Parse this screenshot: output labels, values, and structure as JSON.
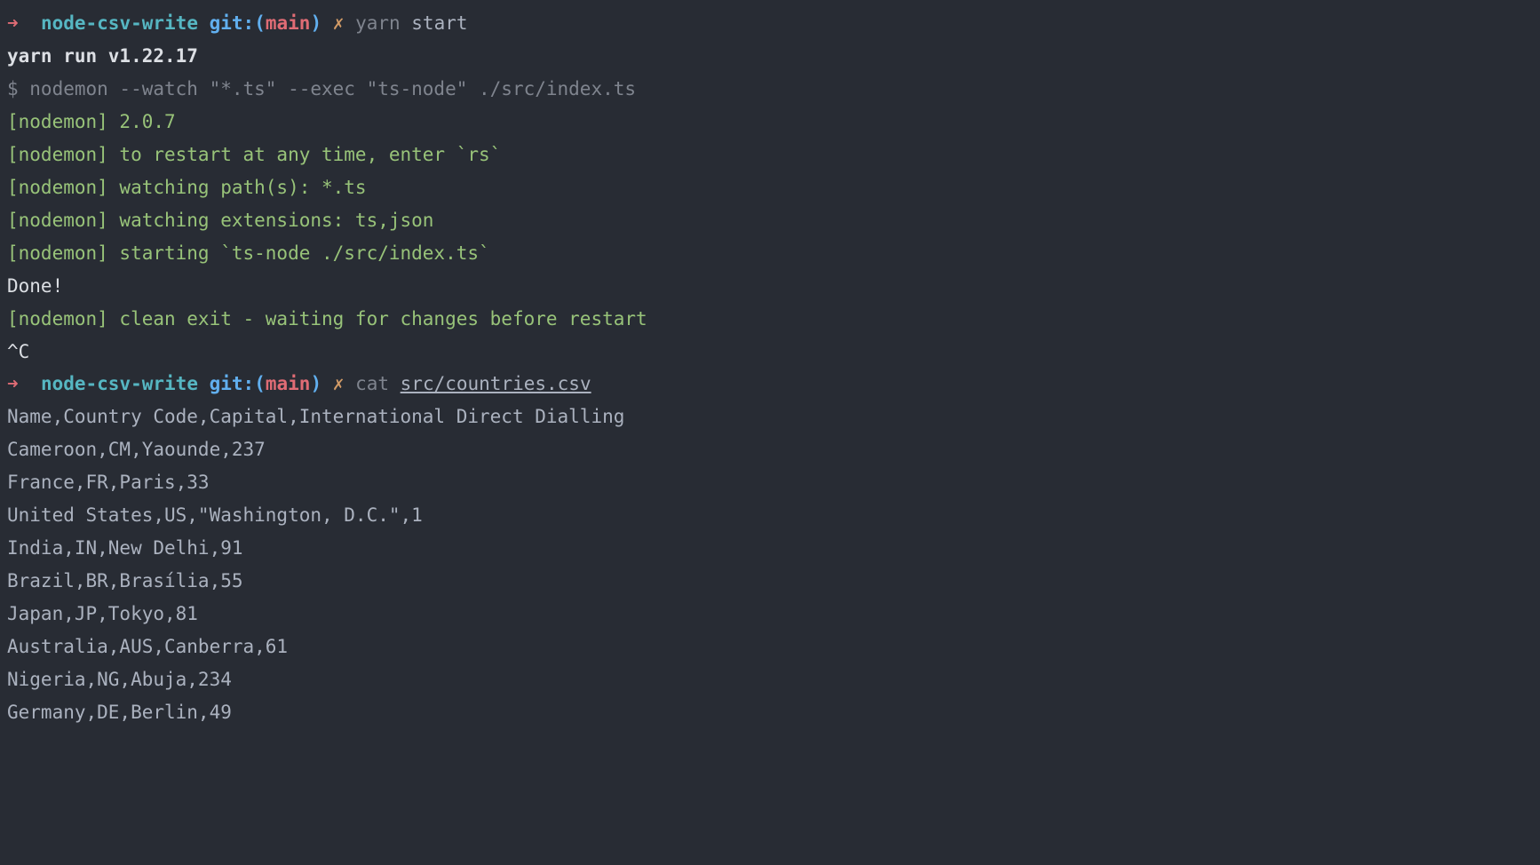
{
  "prompt1": {
    "arrow": "➜",
    "dir": "node-csv-write",
    "git_label": "git:",
    "open_paren": "(",
    "branch": "main",
    "close_paren": ")",
    "dirty": "✗",
    "cmd_head": "yarn",
    "cmd_rest": " start"
  },
  "yarn_version": "yarn run v1.22.17",
  "nodemon_cmd": "$ nodemon --watch \"*.ts\" --exec \"ts-node\" ./src/index.ts",
  "nodemon_lines": [
    "[nodemon] 2.0.7",
    "[nodemon] to restart at any time, enter `rs`",
    "[nodemon] watching path(s): *.ts",
    "[nodemon] watching extensions: ts,json",
    "[nodemon] starting `ts-node ./src/index.ts`"
  ],
  "done": "Done!",
  "nodemon_exit": "[nodemon] clean exit - waiting for changes before restart",
  "interrupt": "^C",
  "prompt2": {
    "arrow": "➜",
    "dir": "node-csv-write",
    "git_label": "git:",
    "open_paren": "(",
    "branch": "main",
    "close_paren": ")",
    "dirty": "✗",
    "cmd_head": "cat",
    "cmd_rest": " ",
    "cmd_file": "src/countries.csv"
  },
  "csv_lines": [
    "Name,Country Code,Capital,International Direct Dialling",
    "Cameroon,CM,Yaounde,237",
    "France,FR,Paris,33",
    "United States,US,\"Washington, D.C.\",1",
    "India,IN,New Delhi,91",
    "Brazil,BR,Brasília,55",
    "Japan,JP,Tokyo,81",
    "Australia,AUS,Canberra,61",
    "Nigeria,NG,Abuja,234",
    "Germany,DE,Berlin,49"
  ]
}
